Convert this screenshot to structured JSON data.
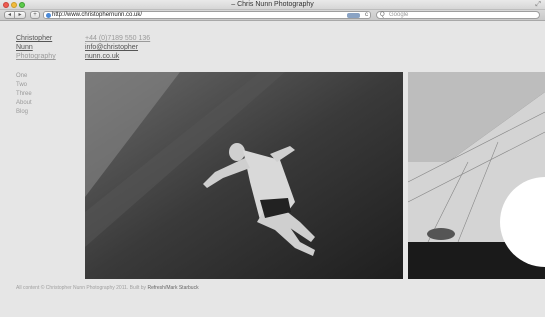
{
  "window": {
    "title": "– Chris Nunn Photography"
  },
  "toolbar": {
    "back_label": "◂",
    "forward_label": "▸",
    "add_label": "+",
    "url": "http://www.christophernunn.co.uk/",
    "reload_label": "c",
    "search_placeholder": "Google",
    "search_glyph": "Q"
  },
  "brand": {
    "line1": "Christopher",
    "line2": "Nunn",
    "line3": "Photography"
  },
  "contact": {
    "phone": "+44 (0)7189 550 136",
    "email_line1": "info@christopher",
    "email_line2": "nunn.co.uk"
  },
  "nav": {
    "items": [
      "One",
      "Two",
      "Three",
      "About",
      "Blog"
    ]
  },
  "footer": {
    "text": "All content © Christopher Nunn Photography 2011. Built by ",
    "credit": "Refresh/Mark Starbuck"
  }
}
